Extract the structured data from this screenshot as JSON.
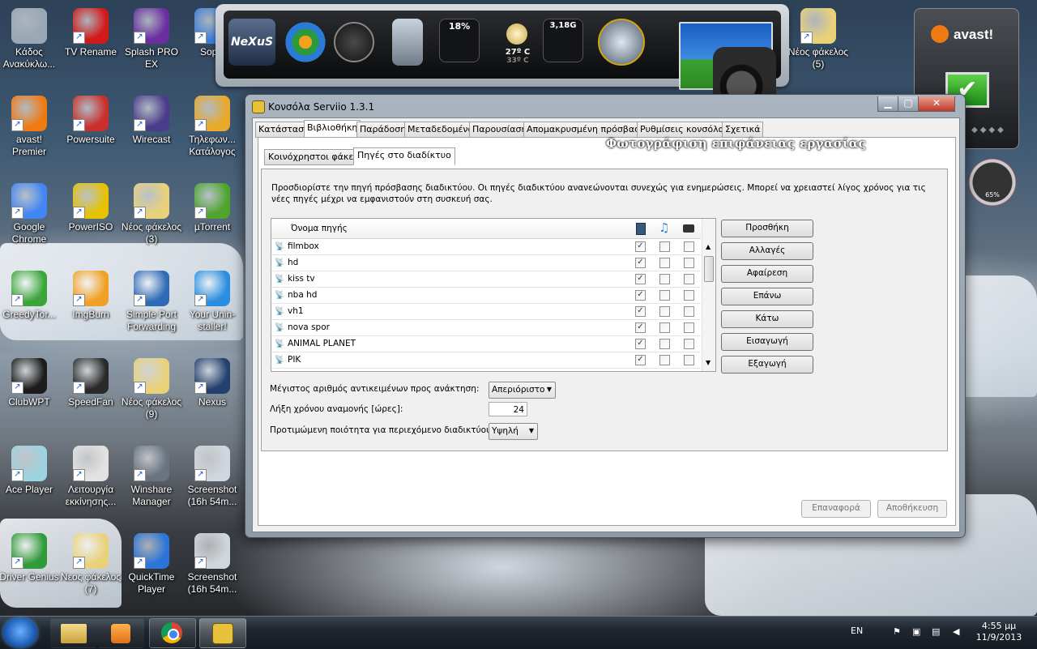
{
  "desktop": {
    "icons": [
      {
        "label": "Κάδος Ανακύκλω...",
        "color": "#9aa7b4"
      },
      {
        "label": "TV Rename",
        "color": "#d11a1a"
      },
      {
        "label": "Splash PRO EX",
        "color": "#6a2ea0"
      },
      {
        "label": "SopC",
        "color": "#3d7fd6"
      },
      {
        "label": "avast! Premier",
        "color": "#f07a12"
      },
      {
        "label": "Powersuite",
        "color": "#c9302c"
      },
      {
        "label": "Wirecast",
        "color": "#4b3b8c"
      },
      {
        "label": "Τηλεφων... Κατάλογος",
        "color": "#e9a92a"
      },
      {
        "label": "Google Chrome",
        "color": "#4285f4"
      },
      {
        "label": "PowerISO",
        "color": "#e6c200"
      },
      {
        "label": "Νέος φάκελος (3)",
        "color": "#e9d17a"
      },
      {
        "label": "µTorrent",
        "color": "#4ea52e"
      },
      {
        "label": "GreedyTor...",
        "color": "#3aa63a"
      },
      {
        "label": "ImgBurn",
        "color": "#f0a024"
      },
      {
        "label": "Simple Port Forwarding",
        "color": "#2f6bb5"
      },
      {
        "label": "Your Unin-staller!",
        "color": "#2a8ee0"
      },
      {
        "label": "ClubWPT",
        "color": "#1c1c1c"
      },
      {
        "label": "SpeedFan",
        "color": "#2a2a2a"
      },
      {
        "label": "Νέος φάκελος (9)",
        "color": "#e9d17a"
      },
      {
        "label": "Nexus",
        "color": "#23406f"
      },
      {
        "label": "Ace Player",
        "color": "#9ed3e0"
      },
      {
        "label": "Λειτουργία εκκίνησης...",
        "color": "#e2e2e2"
      },
      {
        "label": "Winshare Manager",
        "color": "#6a7480"
      },
      {
        "label": "Screenshot (16h 54m...",
        "color": "#cfd6dd"
      },
      {
        "label": "Driver Genius",
        "color": "#2f9a3a"
      },
      {
        "label": "Νεος φάκελος (7)",
        "color": "#e9d17a"
      },
      {
        "label": "QuickTime Player",
        "color": "#2b74d8"
      },
      {
        "label": "Screenshot (16h 54m...",
        "color": "#cfd6dd"
      },
      {
        "label": "Νέος φάκελος (5)",
        "color": "#e9d17a"
      }
    ]
  },
  "dock": {
    "logo": "NeXuS",
    "cpu": "18%",
    "temp": "27º C",
    "temp_sub": "33º C",
    "ram": "3,18G"
  },
  "avast": {
    "brand": "avast!",
    "accent": "#f07a12"
  },
  "gauge": {
    "percent": "65%"
  },
  "watermark": "Φωτογράφιση επιφάνειας εργασίας",
  "window": {
    "title": "Κονσόλα Serviio 1.3.1",
    "caption": {
      "minimize": "▁",
      "maximize": "▢",
      "close": "✕"
    },
    "tabs": [
      "Κατάσταση",
      "Βιβλιοθήκη",
      "Παράδοση",
      "Μεταδεδομένα",
      "Παρουσίαση",
      "Απομακρυσμένη πρόσβαση",
      "Ρυθμίσεις κονσόλας",
      "Σχετικά"
    ],
    "active_tab": "Βιβλιοθήκη",
    "subtabs": [
      "Κοινόχρηστοι φάκελοι",
      "Πηγές στο διαδίκτυο"
    ],
    "active_subtab": "Πηγές στο διαδίκτυο",
    "description": "Προσδιορίστε την πηγή πρόσβασης διαδικτύου. Οι πηγές διαδικτύου ανανεώνονται συνεχώς για ενημερώσεις. Μπορεί να χρειαστεί λίγος χρόνος για τις νέες πηγές μέχρι να εμφανιστούν στη συσκευή σας.",
    "table": {
      "header_name": "Όνομα πηγής",
      "header_icons": [
        "video-icon",
        "music-icon",
        "photo-icon"
      ],
      "rows": [
        {
          "name": "filmbox",
          "video": true,
          "audio": false,
          "image": false
        },
        {
          "name": "hd",
          "video": true,
          "audio": false,
          "image": false
        },
        {
          "name": "kiss tv",
          "video": true,
          "audio": false,
          "image": false
        },
        {
          "name": "nba hd",
          "video": true,
          "audio": false,
          "image": false
        },
        {
          "name": "vh1",
          "video": true,
          "audio": false,
          "image": false
        },
        {
          "name": "nova spor",
          "video": true,
          "audio": false,
          "image": false
        },
        {
          "name": "ANIMAL PLANET",
          "video": true,
          "audio": false,
          "image": false
        },
        {
          "name": "PIK",
          "video": true,
          "audio": false,
          "image": false
        }
      ]
    },
    "actions": [
      "Προσθήκη",
      "Αλλαγές",
      "Αφαίρεση",
      "Επάνω",
      "Κάτω",
      "Εισαγωγή",
      "Εξαγωγή"
    ],
    "fields": {
      "max_items_label": "Μέγιστος αριθμός αντικειμένων προς ανάκτηση:",
      "max_items_value": "Απεριόριστο",
      "timeout_label": "Λήξη χρόνου αναμονής [ώρες]:",
      "timeout_value": "24",
      "quality_label": "Προτιμώμενη ποιότητα για περιεχόμενο διαδικτύου:",
      "quality_value": "Υψηλή"
    },
    "footer": {
      "reset": "Επαναφορά",
      "save": "Αποθήκευση"
    }
  },
  "taskbar": {
    "language": "EN",
    "time": "4:55 μμ",
    "date": "11/9/2013"
  }
}
